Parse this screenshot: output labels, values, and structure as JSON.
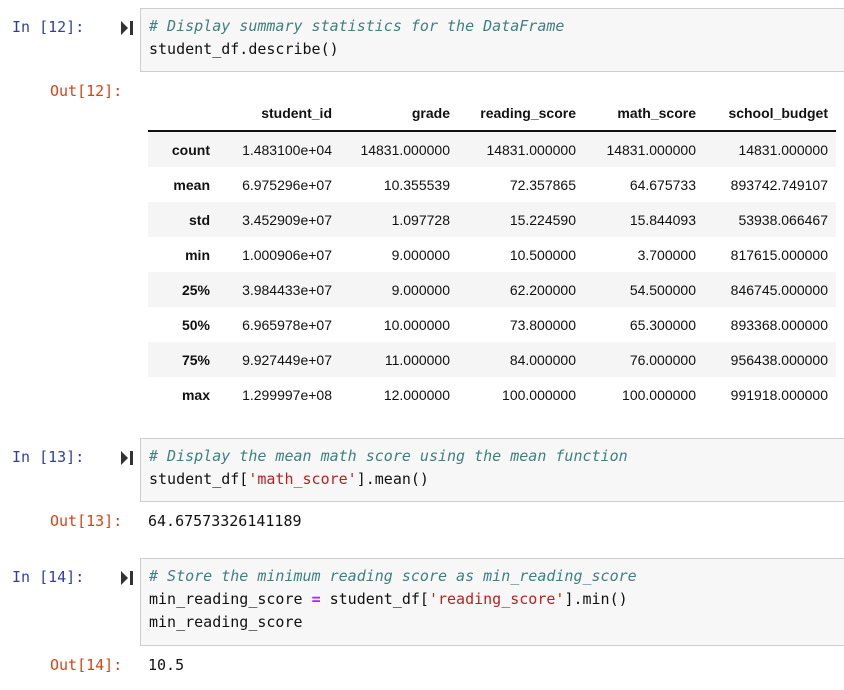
{
  "cells": [
    {
      "in_prompt": "In [12]:",
      "out_prompt": "Out[12]:",
      "code_lines": [
        [
          {
            "t": "comment",
            "v": "# Display summary statistics for the DataFrame"
          }
        ],
        [
          {
            "t": "plain",
            "v": "student_df.describe()"
          }
        ]
      ],
      "table": {
        "columns": [
          "student_id",
          "grade",
          "reading_score",
          "math_score",
          "school_budget"
        ],
        "rows": [
          {
            "label": "count",
            "values": [
              "1.483100e+04",
              "14831.000000",
              "14831.000000",
              "14831.000000",
              "14831.000000"
            ]
          },
          {
            "label": "mean",
            "values": [
              "6.975296e+07",
              "10.355539",
              "72.357865",
              "64.675733",
              "893742.749107"
            ]
          },
          {
            "label": "std",
            "values": [
              "3.452909e+07",
              "1.097728",
              "15.224590",
              "15.844093",
              "53938.066467"
            ]
          },
          {
            "label": "min",
            "values": [
              "1.000906e+07",
              "9.000000",
              "10.500000",
              "3.700000",
              "817615.000000"
            ]
          },
          {
            "label": "25%",
            "values": [
              "3.984433e+07",
              "9.000000",
              "62.200000",
              "54.500000",
              "846745.000000"
            ]
          },
          {
            "label": "50%",
            "values": [
              "6.965978e+07",
              "10.000000",
              "73.800000",
              "65.300000",
              "893368.000000"
            ]
          },
          {
            "label": "75%",
            "values": [
              "9.927449e+07",
              "11.000000",
              "84.000000",
              "76.000000",
              "956438.000000"
            ]
          },
          {
            "label": "max",
            "values": [
              "1.299997e+08",
              "12.000000",
              "100.000000",
              "100.000000",
              "991918.000000"
            ]
          }
        ]
      }
    },
    {
      "in_prompt": "In [13]:",
      "out_prompt": "Out[13]:",
      "code_lines": [
        [
          {
            "t": "comment",
            "v": "# Display the mean math score using the mean function"
          }
        ],
        [
          {
            "t": "plain",
            "v": "student_df["
          },
          {
            "t": "str",
            "v": "'math_score'"
          },
          {
            "t": "plain",
            "v": "].mean()"
          }
        ]
      ],
      "output": "64.67573326141189"
    },
    {
      "in_prompt": "In [14]:",
      "out_prompt": "Out[14]:",
      "code_lines": [
        [
          {
            "t": "comment",
            "v": "# Store the minimum reading score as min_reading_score"
          }
        ],
        [
          {
            "t": "plain",
            "v": "min_reading_score "
          },
          {
            "t": "op",
            "v": "="
          },
          {
            "t": "plain",
            "v": " student_df["
          },
          {
            "t": "str",
            "v": "'reading_score'"
          },
          {
            "t": "plain",
            "v": "].min()"
          }
        ],
        [
          {
            "t": "plain",
            "v": "min_reading_score"
          }
        ]
      ],
      "output": "10.5"
    }
  ]
}
